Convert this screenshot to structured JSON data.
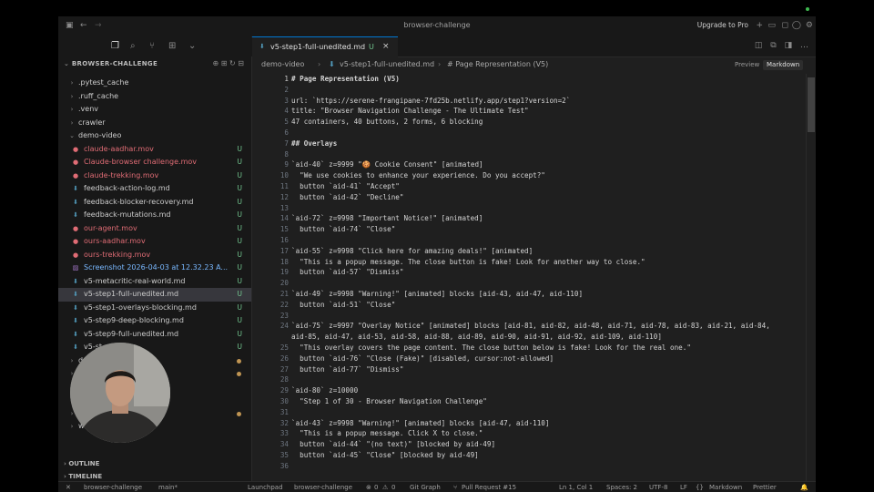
{
  "window": {
    "title": "browser-challenge",
    "upgrade": "Upgrade to Pro"
  },
  "sidebar": {
    "header": "BROWSER-CHALLENGE",
    "items": [
      {
        "label": ".pytest_cache",
        "kind": "folder",
        "indent": 1
      },
      {
        "label": ".ruff_cache",
        "kind": "folder",
        "indent": 1
      },
      {
        "label": ".venv",
        "kind": "folder",
        "indent": 1
      },
      {
        "label": "crawler",
        "kind": "folder",
        "indent": 1
      },
      {
        "label": "demo-video",
        "kind": "folder-open",
        "indent": 1
      },
      {
        "label": "claude-aadhar.mov",
        "kind": "mov",
        "badge": "U"
      },
      {
        "label": "Claude-browser challenge.mov",
        "kind": "mov",
        "badge": "U"
      },
      {
        "label": "claude-trekking.mov",
        "kind": "mov",
        "badge": "U"
      },
      {
        "label": "feedback-action-log.md",
        "kind": "md",
        "badge": "U"
      },
      {
        "label": "feedback-blocker-recovery.md",
        "kind": "md",
        "badge": "U"
      },
      {
        "label": "feedback-mutations.md",
        "kind": "md",
        "badge": "U"
      },
      {
        "label": "our-agent.mov",
        "kind": "mov",
        "badge": "U"
      },
      {
        "label": "ours-aadhar.mov",
        "kind": "mov",
        "badge": "U"
      },
      {
        "label": "ours-trekking.mov",
        "kind": "mov",
        "badge": "U"
      },
      {
        "label": "Screenshot 2026-04-03 at 12.32.23 A...",
        "kind": "img",
        "badge": "U"
      },
      {
        "label": "v5-metacritic-real-world.md",
        "kind": "md",
        "badge": "U"
      },
      {
        "label": "v5-step1-full-unedited.md",
        "kind": "md",
        "badge": "U",
        "selected": true
      },
      {
        "label": "v5-step1-overlays-blocking.md",
        "kind": "md",
        "badge": "U"
      },
      {
        "label": "v5-step9-deep-blocking.md",
        "kind": "md",
        "badge": "U"
      },
      {
        "label": "v5-step9-full-unedited.md",
        "kind": "md",
        "badge": "U"
      },
      {
        "label": "v5-st...d.md",
        "kind": "md",
        "badge": "U"
      },
      {
        "label": "d",
        "kind": "folder",
        "indent": 1,
        "dot": true
      },
      {
        "label": "",
        "kind": "folder",
        "indent": 1,
        "dot": true
      },
      {
        "label": "",
        "kind": "folder",
        "indent": 1
      },
      {
        "label": "",
        "kind": "folder",
        "indent": 1
      },
      {
        "label": "",
        "kind": "folder",
        "indent": 1,
        "dot": true
      },
      {
        "label": "worki...",
        "kind": "folder",
        "indent": 1
      }
    ],
    "outline": "OUTLINE",
    "timeline": "TIMELINE"
  },
  "editor": {
    "tab": {
      "label": "v5-step1-full-unedited.md",
      "status": "U"
    },
    "breadcrumbs": {
      "folder": "demo-video",
      "file": "v5-step1-full-unedited.md",
      "symbol": "# Page Representation (V5)"
    },
    "modes": {
      "preview": "Preview",
      "markdown": "Markdown"
    },
    "lines": [
      {
        "n": "1",
        "t": "# Page Representation (V5)",
        "s": "h"
      },
      {
        "n": "2",
        "t": ""
      },
      {
        "n": "3",
        "t": "url: `https://serene-frangipane-7fd25b.netlify.app/step1?version=2`"
      },
      {
        "n": "4",
        "t": "title: \"Browser Navigation Challenge - The Ultimate Test\""
      },
      {
        "n": "5",
        "t": "47 containers, 40 buttons, 2 forms, 6 blocking"
      },
      {
        "n": "6",
        "t": ""
      },
      {
        "n": "7",
        "t": "## Overlays",
        "s": "h"
      },
      {
        "n": "8",
        "t": ""
      },
      {
        "n": "9",
        "t": "`aid-40` z=9999 \"🍪 Cookie Consent\" [animated]"
      },
      {
        "n": "10",
        "t": "  \"We use cookies to enhance your experience. Do you accept?\""
      },
      {
        "n": "11",
        "t": "  button `aid-41` \"Accept\""
      },
      {
        "n": "12",
        "t": "  button `aid-42` \"Decline\""
      },
      {
        "n": "13",
        "t": ""
      },
      {
        "n": "14",
        "t": "`aid-72` z=9998 \"Important Notice!\" [animated]"
      },
      {
        "n": "15",
        "t": "  button `aid-74` \"Close\""
      },
      {
        "n": "16",
        "t": ""
      },
      {
        "n": "17",
        "t": "`aid-55` z=9998 \"Click here for amazing deals!\" [animated]"
      },
      {
        "n": "18",
        "t": "  \"This is a popup message. The close button is fake! Look for another way to close.\""
      },
      {
        "n": "19",
        "t": "  button `aid-57` \"Dismiss\""
      },
      {
        "n": "20",
        "t": ""
      },
      {
        "n": "21",
        "t": "`aid-49` z=9998 \"Warning!\" [animated] blocks [aid-43, aid-47, aid-110]"
      },
      {
        "n": "22",
        "t": "  button `aid-51` \"Close\""
      },
      {
        "n": "23",
        "t": ""
      },
      {
        "n": "24",
        "t": "`aid-75` z=9997 \"Overlay Notice\" [animated] blocks [aid-81, aid-82, aid-48, aid-71, aid-78, aid-83, aid-21, aid-84,"
      },
      {
        "n": "",
        "t": "aid-85, aid-47, aid-53, aid-58, aid-88, aid-89, aid-90, aid-91, aid-92, aid-109, aid-110]"
      },
      {
        "n": "25",
        "t": "  \"This overlay covers the page content. The close button below is fake! Look for the real one.\""
      },
      {
        "n": "26",
        "t": "  button `aid-76` \"Close (Fake)\" [disabled, cursor:not-allowed]"
      },
      {
        "n": "27",
        "t": "  button `aid-77` \"Dismiss\""
      },
      {
        "n": "28",
        "t": ""
      },
      {
        "n": "29",
        "t": "`aid-80` z=10000"
      },
      {
        "n": "30",
        "t": "  \"Step 1 of 30 - Browser Navigation Challenge\""
      },
      {
        "n": "31",
        "t": ""
      },
      {
        "n": "32",
        "t": "`aid-43` z=9998 \"Warning!\" [animated] blocks [aid-47, aid-110]"
      },
      {
        "n": "33",
        "t": "  \"This is a popup message. Click X to close.\""
      },
      {
        "n": "34",
        "t": "  button `aid-44` \"(no text)\" [blocked by aid-49]"
      },
      {
        "n": "35",
        "t": "  button `aid-45` \"Close\" [blocked by aid-49]"
      },
      {
        "n": "36",
        "t": ""
      }
    ]
  },
  "statusbar": {
    "repo": "browser-challenge",
    "branch": "main*",
    "launchpad": "Launchpad",
    "workspace": "browser-challenge",
    "problems": "0",
    "warnings": "0",
    "gitgraph": "Git Graph",
    "pr": "Pull Request #15",
    "position": "Ln 1, Col 1",
    "spaces": "Spaces: 2",
    "encoding": "UTF-8",
    "eol": "LF",
    "language": "Markdown",
    "prettier": "Prettier"
  },
  "colors": {
    "accent": "#0078d4",
    "untracked": "#73c991",
    "mov": "#e06c75",
    "md": "#519aba"
  }
}
